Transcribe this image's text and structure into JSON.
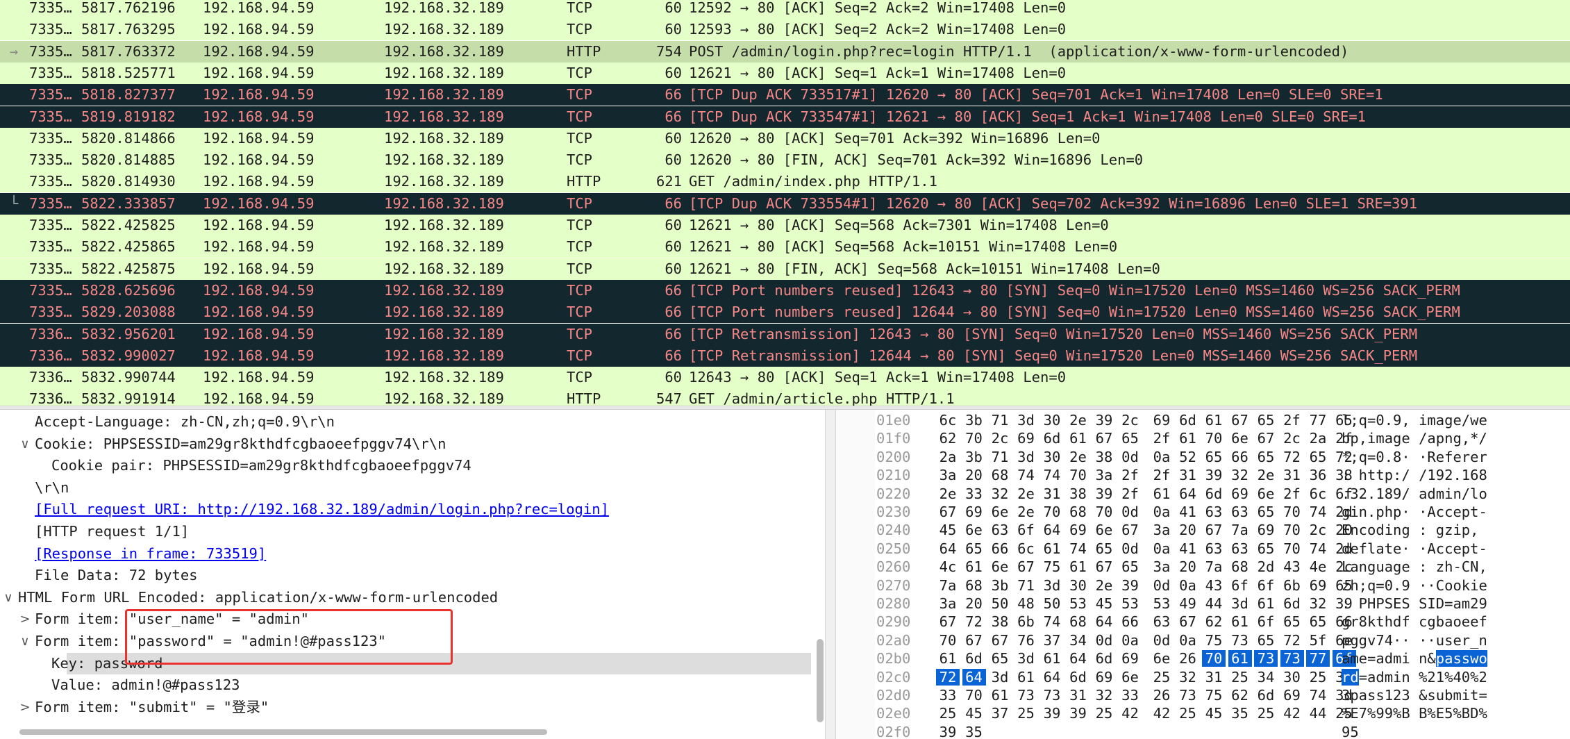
{
  "packets": [
    {
      "no": "7335…",
      "time": "5817.762196",
      "src": "192.168.94.59",
      "dst": "192.168.32.189",
      "proto": "TCP",
      "len": "60",
      "info": "12592 → 80 [ACK] Seq=2 Ack=2 Win=17408 Len=0",
      "style": "green",
      "marker": ""
    },
    {
      "no": "7335…",
      "time": "5817.763295",
      "src": "192.168.94.59",
      "dst": "192.168.32.189",
      "proto": "TCP",
      "len": "60",
      "info": "12593 → 80 [ACK] Seq=2 Ack=2 Win=17408 Len=0",
      "style": "green",
      "marker": ""
    },
    {
      "no": "7335…",
      "time": "5817.763372",
      "src": "192.168.94.59",
      "dst": "192.168.32.189",
      "proto": "HTTP",
      "len": "754",
      "info": "POST /admin/login.php?rec=login HTTP/1.1  (application/x-www-form-urlencoded)",
      "style": "sel",
      "marker": "→"
    },
    {
      "no": "7335…",
      "time": "5818.525771",
      "src": "192.168.94.59",
      "dst": "192.168.32.189",
      "proto": "TCP",
      "len": "60",
      "info": "12621 → 80 [ACK] Seq=1 Ack=1 Win=17408 Len=0",
      "style": "green",
      "marker": ""
    },
    {
      "no": "7335…",
      "time": "5818.827377",
      "src": "192.168.94.59",
      "dst": "192.168.32.189",
      "proto": "TCP",
      "len": "66",
      "info": "[TCP Dup ACK 733517#1] 12620 → 80 [ACK] Seq=701 Ack=1 Win=17408 Len=0 SLE=0 SRE=1",
      "style": "dark",
      "marker": ""
    },
    {
      "no": "7335…",
      "time": "5819.819182",
      "src": "192.168.94.59",
      "dst": "192.168.32.189",
      "proto": "TCP",
      "len": "66",
      "info": "[TCP Dup ACK 733547#1] 12621 → 80 [ACK] Seq=1 Ack=1 Win=17408 Len=0 SLE=0 SRE=1",
      "style": "dark",
      "marker": ""
    },
    {
      "no": "7335…",
      "time": "5820.814866",
      "src": "192.168.94.59",
      "dst": "192.168.32.189",
      "proto": "TCP",
      "len": "60",
      "info": "12620 → 80 [ACK] Seq=701 Ack=392 Win=16896 Len=0",
      "style": "green",
      "marker": ""
    },
    {
      "no": "7335…",
      "time": "5820.814885",
      "src": "192.168.94.59",
      "dst": "192.168.32.189",
      "proto": "TCP",
      "len": "60",
      "info": "12620 → 80 [FIN, ACK] Seq=701 Ack=392 Win=16896 Len=0",
      "style": "green",
      "marker": ""
    },
    {
      "no": "7335…",
      "time": "5820.814930",
      "src": "192.168.94.59",
      "dst": "192.168.32.189",
      "proto": "HTTP",
      "len": "621",
      "info": "GET /admin/index.php HTTP/1.1",
      "style": "green",
      "marker": ""
    },
    {
      "no": "7335…",
      "time": "5822.333857",
      "src": "192.168.94.59",
      "dst": "192.168.32.189",
      "proto": "TCP",
      "len": "66",
      "info": "[TCP Dup ACK 733554#1] 12620 → 80 [ACK] Seq=702 Ack=392 Win=16896 Len=0 SLE=1 SRE=391",
      "style": "dark",
      "marker": "└"
    },
    {
      "no": "7335…",
      "time": "5822.425825",
      "src": "192.168.94.59",
      "dst": "192.168.32.189",
      "proto": "TCP",
      "len": "60",
      "info": "12621 → 80 [ACK] Seq=568 Ack=7301 Win=17408 Len=0",
      "style": "green",
      "marker": ""
    },
    {
      "no": "7335…",
      "time": "5822.425865",
      "src": "192.168.94.59",
      "dst": "192.168.32.189",
      "proto": "TCP",
      "len": "60",
      "info": "12621 → 80 [ACK] Seq=568 Ack=10151 Win=17408 Len=0",
      "style": "green",
      "marker": ""
    },
    {
      "no": "7335…",
      "time": "5822.425875",
      "src": "192.168.94.59",
      "dst": "192.168.32.189",
      "proto": "TCP",
      "len": "60",
      "info": "12621 → 80 [FIN, ACK] Seq=568 Ack=10151 Win=17408 Len=0",
      "style": "green",
      "marker": ""
    },
    {
      "no": "7335…",
      "time": "5828.625696",
      "src": "192.168.94.59",
      "dst": "192.168.32.189",
      "proto": "TCP",
      "len": "66",
      "info": "[TCP Port numbers reused] 12643 → 80 [SYN] Seq=0 Win=17520 Len=0 MSS=1460 WS=256 SACK_PERM",
      "style": "dark",
      "marker": ""
    },
    {
      "no": "7335…",
      "time": "5829.203088",
      "src": "192.168.94.59",
      "dst": "192.168.32.189",
      "proto": "TCP",
      "len": "66",
      "info": "[TCP Port numbers reused] 12644 → 80 [SYN] Seq=0 Win=17520 Len=0 MSS=1460 WS=256 SACK_PERM",
      "style": "dark",
      "marker": ""
    },
    {
      "no": "7336…",
      "time": "5832.956201",
      "src": "192.168.94.59",
      "dst": "192.168.32.189",
      "proto": "TCP",
      "len": "66",
      "info": "[TCP Retransmission] 12643 → 80 [SYN] Seq=0 Win=17520 Len=0 MSS=1460 WS=256 SACK_PERM",
      "style": "dark",
      "marker": ""
    },
    {
      "no": "7336…",
      "time": "5832.990027",
      "src": "192.168.94.59",
      "dst": "192.168.32.189",
      "proto": "TCP",
      "len": "66",
      "info": "[TCP Retransmission] 12644 → 80 [SYN] Seq=0 Win=17520 Len=0 MSS=1460 WS=256 SACK_PERM",
      "style": "dark",
      "marker": ""
    },
    {
      "no": "7336…",
      "time": "5832.990744",
      "src": "192.168.94.59",
      "dst": "192.168.32.189",
      "proto": "TCP",
      "len": "60",
      "info": "12643 → 80 [ACK] Seq=1 Ack=1 Win=17408 Len=0",
      "style": "green",
      "marker": ""
    },
    {
      "no": "7336…",
      "time": "5832.991914",
      "src": "192.168.94.59",
      "dst": "192.168.32.189",
      "proto": "HTTP",
      "len": "547",
      "info": "GET /admin/article.php HTTP/1.1",
      "style": "green",
      "marker": ""
    }
  ],
  "details": [
    {
      "text": "Accept-Language: zh-CN,zh;q=0.9\\r\\n",
      "toggle": "",
      "level": 2,
      "link": false,
      "highlight": false
    },
    {
      "text": "Cookie: PHPSESSID=am29gr8kthdfcgbaoeefpggv74\\r\\n",
      "toggle": "∨",
      "level": 2,
      "link": false,
      "highlight": false
    },
    {
      "text": "Cookie pair: PHPSESSID=am29gr8kthdfcgbaoeefpggv74",
      "toggle": "",
      "level": 3,
      "link": false,
      "highlight": false
    },
    {
      "text": "\\r\\n",
      "toggle": "",
      "level": 2,
      "link": false,
      "highlight": false
    },
    {
      "text": "[Full request URI: http://192.168.32.189/admin/login.php?rec=login]",
      "toggle": "",
      "level": 2,
      "link": true,
      "highlight": false
    },
    {
      "text": "[HTTP request 1/1]",
      "toggle": "",
      "level": 2,
      "link": false,
      "highlight": false
    },
    {
      "text": "[Response in frame: 733519]",
      "toggle": "",
      "level": 2,
      "link": true,
      "highlight": false
    },
    {
      "text": "File Data: 72 bytes",
      "toggle": "",
      "level": 2,
      "link": false,
      "highlight": false
    },
    {
      "text": "HTML Form URL Encoded: application/x-www-form-urlencoded",
      "toggle": "∨",
      "level": 1,
      "link": false,
      "highlight": false
    },
    {
      "text": "Form item: \"user_name\" = \"admin\"",
      "toggle": ">",
      "level": 2,
      "link": false,
      "highlight": false
    },
    {
      "text": "Form item: \"password\" = \"admin!@#pass123\"",
      "toggle": "∨",
      "level": 2,
      "link": false,
      "highlight": false
    },
    {
      "text": "Key: password",
      "toggle": "",
      "level": 3,
      "link": false,
      "highlight": true
    },
    {
      "text": "Value: admin!@#pass123",
      "toggle": "",
      "level": 3,
      "link": false,
      "highlight": false
    },
    {
      "text": "Form item: \"submit\" = \"登录\"",
      "toggle": ">",
      "level": 2,
      "link": false,
      "highlight": false
    }
  ],
  "bytes": [
    {
      "offset": "01e0",
      "hex": [
        "6c",
        "3b",
        "71",
        "3d",
        "30",
        "2e",
        "39",
        "2c",
        "69",
        "6d",
        "61",
        "67",
        "65",
        "2f",
        "77",
        "65"
      ],
      "ascii": "l;q=0.9, image/we"
    },
    {
      "offset": "01f0",
      "hex": [
        "62",
        "70",
        "2c",
        "69",
        "6d",
        "61",
        "67",
        "65",
        "2f",
        "61",
        "70",
        "6e",
        "67",
        "2c",
        "2a",
        "2f"
      ],
      "ascii": "bp,image /apng,*/"
    },
    {
      "offset": "0200",
      "hex": [
        "2a",
        "3b",
        "71",
        "3d",
        "30",
        "2e",
        "38",
        "0d",
        "0a",
        "52",
        "65",
        "66",
        "65",
        "72",
        "65",
        "72"
      ],
      "ascii": "*;q=0.8· ·Referer"
    },
    {
      "offset": "0210",
      "hex": [
        "3a",
        "20",
        "68",
        "74",
        "74",
        "70",
        "3a",
        "2f",
        "2f",
        "31",
        "39",
        "32",
        "2e",
        "31",
        "36",
        "38"
      ],
      "ascii": ": http:/ /192.168"
    },
    {
      "offset": "0220",
      "hex": [
        "2e",
        "33",
        "32",
        "2e",
        "31",
        "38",
        "39",
        "2f",
        "61",
        "64",
        "6d",
        "69",
        "6e",
        "2f",
        "6c",
        "6f"
      ],
      "ascii": ".32.189/ admin/lo"
    },
    {
      "offset": "0230",
      "hex": [
        "67",
        "69",
        "6e",
        "2e",
        "70",
        "68",
        "70",
        "0d",
        "0a",
        "41",
        "63",
        "63",
        "65",
        "70",
        "74",
        "2d"
      ],
      "ascii": "gin.php· ·Accept-"
    },
    {
      "offset": "0240",
      "hex": [
        "45",
        "6e",
        "63",
        "6f",
        "64",
        "69",
        "6e",
        "67",
        "3a",
        "20",
        "67",
        "7a",
        "69",
        "70",
        "2c",
        "20"
      ],
      "ascii": "Encoding : gzip, "
    },
    {
      "offset": "0250",
      "hex": [
        "64",
        "65",
        "66",
        "6c",
        "61",
        "74",
        "65",
        "0d",
        "0a",
        "41",
        "63",
        "63",
        "65",
        "70",
        "74",
        "2d"
      ],
      "ascii": "deflate· ·Accept-"
    },
    {
      "offset": "0260",
      "hex": [
        "4c",
        "61",
        "6e",
        "67",
        "75",
        "61",
        "67",
        "65",
        "3a",
        "20",
        "7a",
        "68",
        "2d",
        "43",
        "4e",
        "2c"
      ],
      "ascii": "Language : zh-CN,"
    },
    {
      "offset": "0270",
      "hex": [
        "7a",
        "68",
        "3b",
        "71",
        "3d",
        "30",
        "2e",
        "39",
        "0d",
        "0a",
        "43",
        "6f",
        "6f",
        "6b",
        "69",
        "65"
      ],
      "ascii": "zh;q=0.9 ··Cookie"
    },
    {
      "offset": "0280",
      "hex": [
        "3a",
        "20",
        "50",
        "48",
        "50",
        "53",
        "45",
        "53",
        "53",
        "49",
        "44",
        "3d",
        "61",
        "6d",
        "32",
        "39"
      ],
      "ascii": ": PHPSES SID=am29"
    },
    {
      "offset": "0290",
      "hex": [
        "67",
        "72",
        "38",
        "6b",
        "74",
        "68",
        "64",
        "66",
        "63",
        "67",
        "62",
        "61",
        "6f",
        "65",
        "65",
        "66"
      ],
      "ascii": "gr8kthdf cgbaoeef"
    },
    {
      "offset": "02a0",
      "hex": [
        "70",
        "67",
        "67",
        "76",
        "37",
        "34",
        "0d",
        "0a",
        "0d",
        "0a",
        "75",
        "73",
        "65",
        "72",
        "5f",
        "6e"
      ],
      "ascii": "pggv74·· ··user_n"
    },
    {
      "offset": "02b0",
      "hex": [
        "61",
        "6d",
        "65",
        "3d",
        "61",
        "64",
        "6d",
        "69",
        "6e",
        "26",
        "70",
        "61",
        "73",
        "73",
        "77",
        "6f"
      ],
      "ascii": "ame=admi n&passwo",
      "sel_from": 10,
      "ascii_pre": "ame=admi n&",
      "ascii_sel": "passwo",
      "ascii_post": ""
    },
    {
      "offset": "02c0",
      "hex": [
        "72",
        "64",
        "3d",
        "61",
        "64",
        "6d",
        "69",
        "6e",
        "25",
        "32",
        "31",
        "25",
        "34",
        "30",
        "25",
        "32"
      ],
      "ascii": "rd=admin %21%40%2",
      "sel_to": 1,
      "ascii_pre": "",
      "ascii_sel": "rd",
      "ascii_post": "=admin %21%40%2"
    },
    {
      "offset": "02d0",
      "hex": [
        "33",
        "70",
        "61",
        "73",
        "73",
        "31",
        "32",
        "33",
        "26",
        "73",
        "75",
        "62",
        "6d",
        "69",
        "74",
        "3d"
      ],
      "ascii": "3pass123 &submit="
    },
    {
      "offset": "02e0",
      "hex": [
        "25",
        "45",
        "37",
        "25",
        "39",
        "39",
        "25",
        "42",
        "42",
        "25",
        "45",
        "35",
        "25",
        "42",
        "44",
        "25"
      ],
      "ascii": "%E7%99%B B%E5%BD%"
    },
    {
      "offset": "02f0",
      "hex": [
        "39",
        "35"
      ],
      "ascii": "95"
    }
  ]
}
